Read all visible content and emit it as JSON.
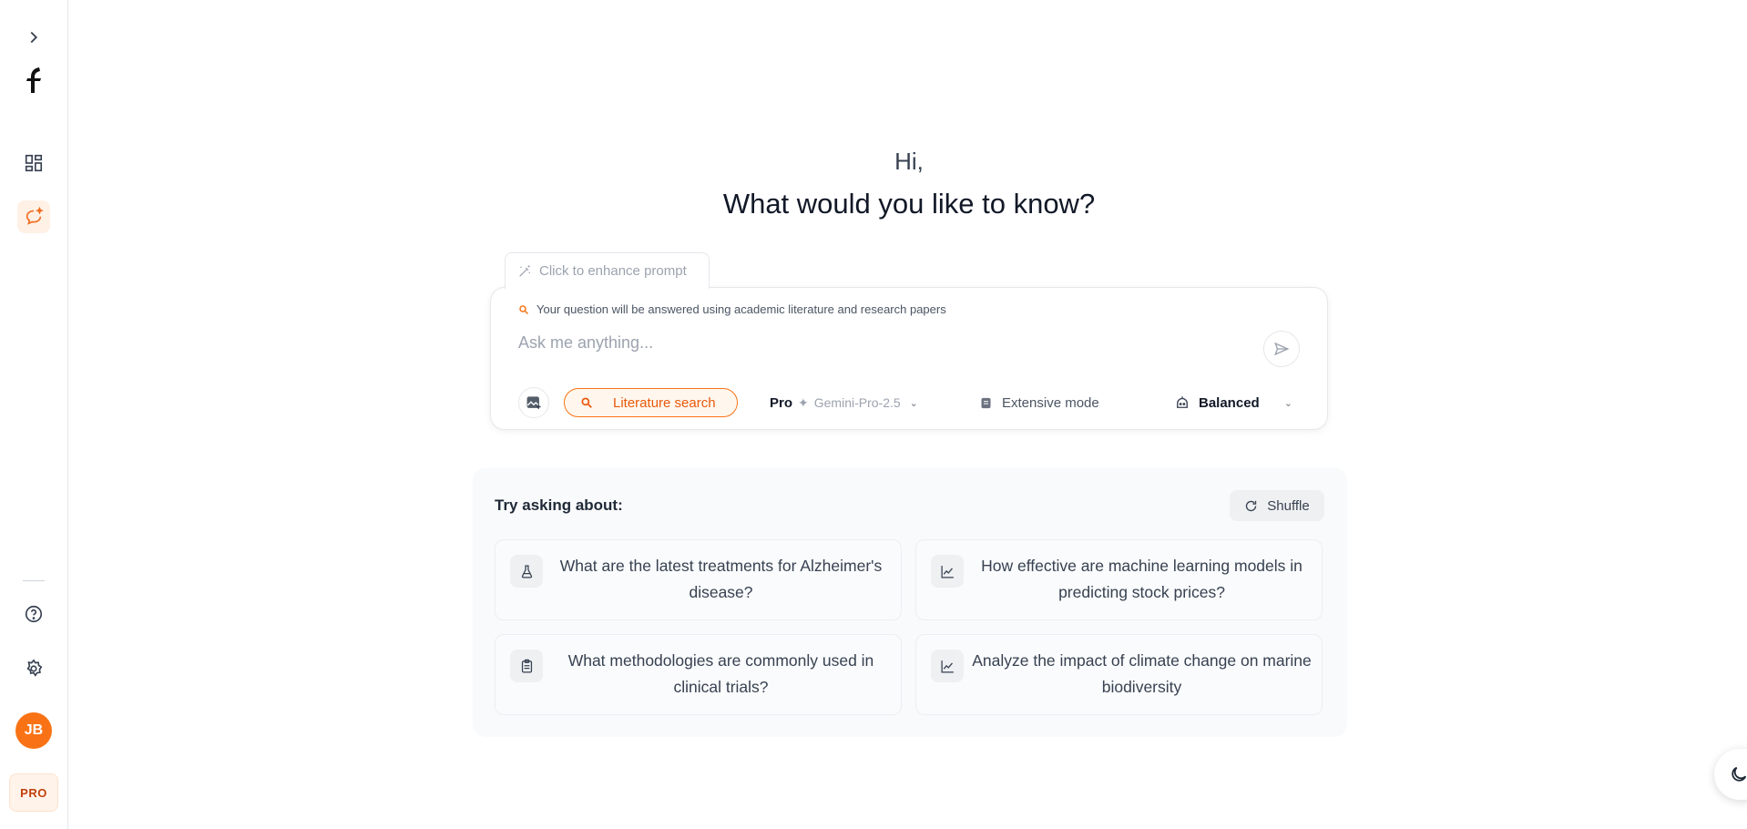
{
  "sidebar": {
    "items": [
      {
        "icon": "chevron-right-icon",
        "label": "Expand sidebar"
      },
      {
        "icon": "logo-icon"
      },
      {
        "icon": "dashboard-icon"
      },
      {
        "icon": "chat-sparkle-icon",
        "active": true
      },
      {
        "icon": "help-icon"
      },
      {
        "icon": "settings-icon"
      }
    ],
    "avatar_initials": "JB",
    "plan_badge": "PRO"
  },
  "greeting": {
    "hi": "Hi,",
    "question": "What would you like to know?"
  },
  "query": {
    "enhance_label": "Click to enhance prompt",
    "hint": "Your question will be answered using academic literature and research papers",
    "placeholder": "Ask me anything...",
    "value": "",
    "literature_search_label": "Literature search",
    "model_tier": "Pro",
    "model_name": "Gemini-Pro-2.5",
    "extensive_mode_label": "Extensive mode",
    "mode_label": "Balanced"
  },
  "suggestions": {
    "title": "Try asking about:",
    "shuffle_label": "Shuffle",
    "items": [
      {
        "icon": "flask-icon",
        "text": "What are the latest treatments for Alzheimer's disease?"
      },
      {
        "icon": "line-chart-icon",
        "text": "How effective are machine learning models in predicting stock prices?"
      },
      {
        "icon": "clipboard-icon",
        "text": "What methodologies are commonly used in clinical trials?"
      },
      {
        "icon": "line-chart-icon",
        "text": "Analyze the impact of climate change on marine biodiversity"
      }
    ]
  },
  "colors": {
    "accent": "#f97316",
    "accent_dark": "#ea580c",
    "text": "#1f2937"
  }
}
